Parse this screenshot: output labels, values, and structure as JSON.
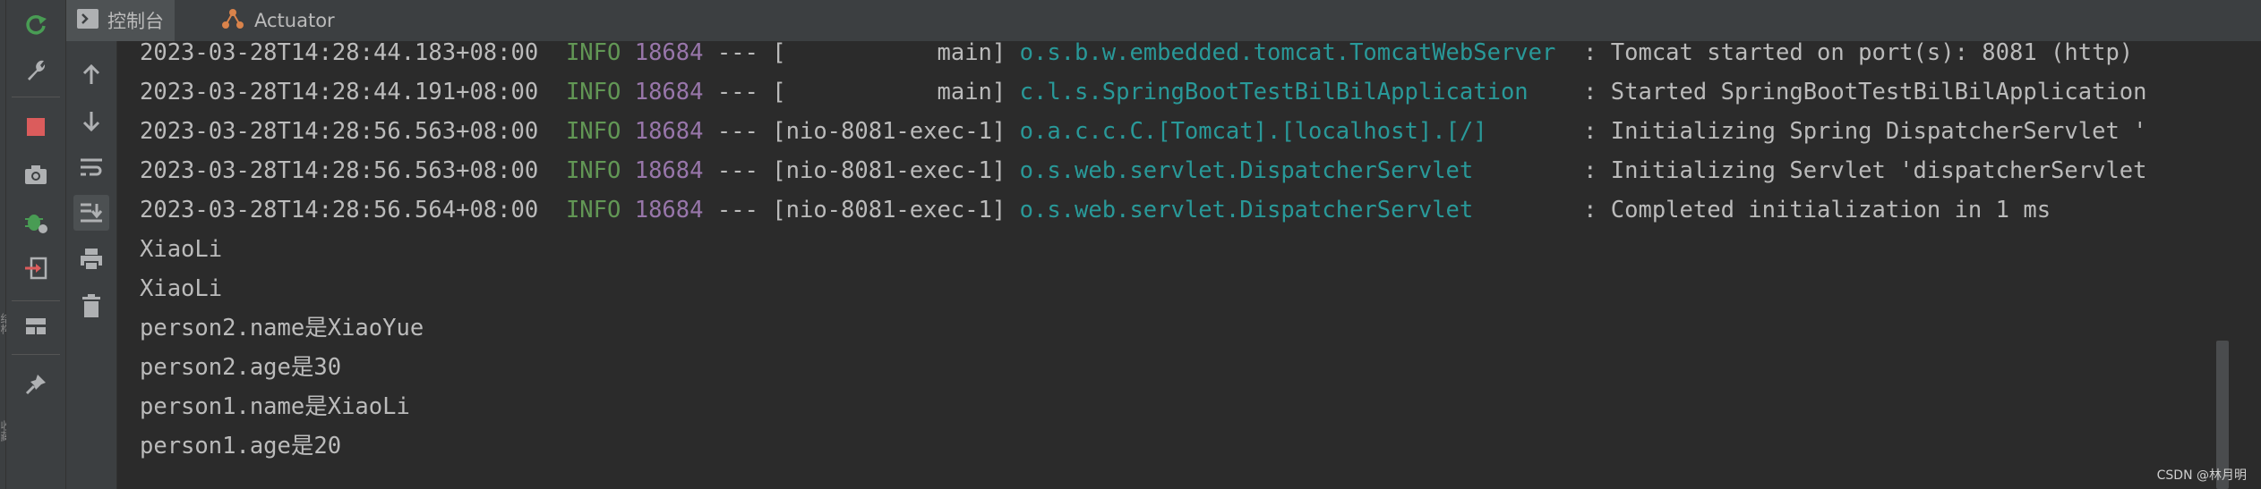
{
  "left_rail": {
    "vtext_top": "结构",
    "vtext_bottom": "收藏"
  },
  "tabs": [
    {
      "label": "控制台",
      "icon": "console-icon",
      "active": true
    },
    {
      "label": "Actuator",
      "icon": "actuator-icon",
      "active": false
    }
  ],
  "toolbar_primary": [
    "rerun-icon",
    "wrench-icon",
    "stop-icon",
    "camera-icon",
    "debug-icon",
    "exit-icon",
    "layout-icon",
    "pin-icon"
  ],
  "toolbar_secondary": [
    "arrow-up-icon",
    "arrow-down-icon",
    "soft-wrap-icon",
    "scroll-to-end-icon",
    "print-icon",
    "trash-icon"
  ],
  "log_lines": [
    {
      "ts": "2023-03-28T14:28:44.183+08:00",
      "level": "INFO",
      "pid": "18684",
      "sep": "---",
      "thread": "[           main]",
      "logger": "o.s.b.w.embedded.tomcat.TomcatWebServer ",
      "msg": " : Tomcat started on port(s): 8081 (http)"
    },
    {
      "ts": "2023-03-28T14:28:44.191+08:00",
      "level": "INFO",
      "pid": "18684",
      "sep": "---",
      "thread": "[           main]",
      "logger": "c.l.s.SpringBootTestBilBilApplication   ",
      "msg": " : Started SpringBootTestBilBilApplication"
    },
    {
      "ts": "2023-03-28T14:28:56.563+08:00",
      "level": "INFO",
      "pid": "18684",
      "sep": "---",
      "thread": "[nio-8081-exec-1]",
      "logger": "o.a.c.c.C.[Tomcat].[localhost].[/]      ",
      "msg": " : Initializing Spring DispatcherServlet '"
    },
    {
      "ts": "2023-03-28T14:28:56.563+08:00",
      "level": "INFO",
      "pid": "18684",
      "sep": "---",
      "thread": "[nio-8081-exec-1]",
      "logger": "o.s.web.servlet.DispatcherServlet       ",
      "msg": " : Initializing Servlet 'dispatcherServlet"
    },
    {
      "ts": "2023-03-28T14:28:56.564+08:00",
      "level": "INFO",
      "pid": "18684",
      "sep": "---",
      "thread": "[nio-8081-exec-1]",
      "logger": "o.s.web.servlet.DispatcherServlet       ",
      "msg": " : Completed initialization in 1 ms"
    }
  ],
  "output_lines": [
    "XiaoLi",
    "XiaoLi",
    "person2.name是XiaoYue",
    "person2.age是30",
    "person1.name是XiaoLi",
    "person1.age是20"
  ],
  "watermark": "CSDN @林月明",
  "colors": {
    "info_level": "#629755",
    "pid": "#9876aa",
    "logger": "#299999",
    "text": "#bbbbbb",
    "stop_red": "#db5c5c",
    "rerun_green": "#499c54"
  }
}
